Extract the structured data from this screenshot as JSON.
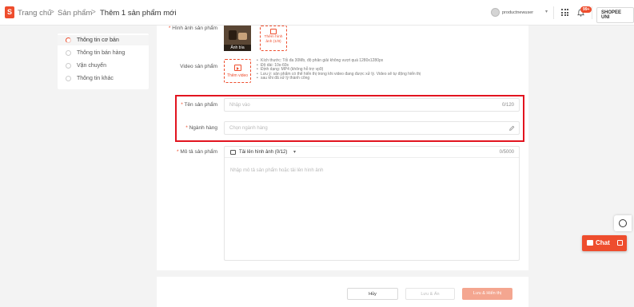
{
  "header": {
    "breadcrumb": [
      "Trang chủ",
      "Sản phẩm",
      "Thêm 1 sản phẩm mới"
    ],
    "separator": ">",
    "username": "productnewuser",
    "notification_badge": "99+",
    "shop_button": "SHOPEE UNI"
  },
  "steps": [
    {
      "label": "Thông tin cơ bản",
      "active": true
    },
    {
      "label": "Thông tin bán hàng",
      "active": false
    },
    {
      "label": "Vận chuyển",
      "active": false
    },
    {
      "label": "Thông tin khác",
      "active": false
    }
  ],
  "form": {
    "images": {
      "label": "Hình ảnh sản phẩm",
      "cover_caption": "Ảnh bìa",
      "add_label": "Thêm hình ảnh (1/9)"
    },
    "video": {
      "label": "Video sản phẩm",
      "add_label": "Thêm video",
      "notes": [
        "Kích thước: Tối đa 30Mb, độ phân giải không vượt quá 1280x1280px",
        "Độ dài: 10s-60s",
        "Định dạng: MP4 (không hỗ trợ vp9)",
        "Lưu ý: sản phẩm có thể hiển thị trong khi video đang được xử lý. Video sẽ tự động hiển thị",
        "sau khi đã xử lý thành công"
      ]
    },
    "name": {
      "label": "Tên sản phẩm",
      "placeholder": "Nhập vào",
      "counter": "0/120"
    },
    "category": {
      "label": "Ngành hàng",
      "placeholder": "Chọn ngành hàng"
    },
    "description": {
      "label": "Mô tả sản phẩm",
      "upload": "Tải lên hình ảnh (0/12)",
      "counter": "0/5000",
      "placeholder": "Nhập mô tả sản phẩm hoặc tải lên hình ảnh"
    },
    "required_mark": "*"
  },
  "actions": {
    "cancel": "Hủy",
    "save_hide": "Lưu & Ẩn",
    "save_show": "Lưu & Hiển thị"
  },
  "chat": {
    "label": "Chat"
  },
  "colors": {
    "accent": "#ee4d2d",
    "highlight_border": "#e2141f"
  }
}
